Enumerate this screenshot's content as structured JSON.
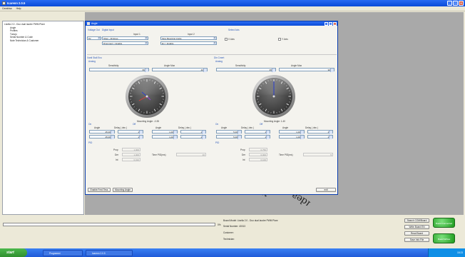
{
  "app": {
    "title": "Icarenn 2.0.5",
    "menu": [
      "Cerahisa",
      "Help"
    ]
  },
  "tree": {
    "root": "Lisella 2.0 - Duo dual Iaodre PWM Pianr",
    "children": [
      "Angle",
      "Profiles",
      "Tunujo",
      "Serial Number & Code",
      "Note Technician & Customer"
    ]
  },
  "child": {
    "title": "Angle",
    "voltage_out_label": "Voltage Out",
    "digital_input_label": "Digital Input",
    "input1_label": "Input 1",
    "input2_label": "Input 2",
    "select_axis_label": "Select Axis",
    "voltage_value": "5V",
    "input1_value": "Shep - All Enes",
    "input1b_value": "Dinonnect > Enable",
    "input2_value": "Sing Mounting Angle",
    "input2b_value": "En > Enable",
    "x_axis_label": "X Axis",
    "y_axis_label": "Y Axis",
    "panels": [
      {
        "title": "Xanti Stall Eno",
        "analog": "Analog",
        "sensitivity_label": "Sensitivity",
        "sensitivity_value": "80",
        "angle_max_label": "Angle Max",
        "angle_max_value": "40",
        "mounting_label": "Mounting Angle: -0.35",
        "on_label": "On",
        "off_label": "Off",
        "col_angle": "Angle",
        "col_delay": "Delay ( dec )",
        "row1": [
          "45,00",
          "1",
          "1,00",
          "1"
        ],
        "row2": [
          "45,00",
          "1",
          "1,00",
          "1"
        ],
        "pid_label": "PID",
        "prop_label": "Prop",
        "der_label": "Der",
        "int_label": "Int",
        "prop_val": "1,000",
        "der_val": "1,000",
        "int_val": "0,010",
        "time_label": "Time PID(ms)",
        "time_val": "10"
      },
      {
        "title": "Din Cmert",
        "analog": "Analog",
        "sensitivity_label": "Sensitivity",
        "sensitivity_value": "95",
        "angle_max_label": "Angle Max",
        "angle_max_value": "90",
        "mounting_label": "Mounting Angle: 1.40",
        "on_label": "On",
        "off_label": "Off",
        "col_angle": "Angle",
        "col_delay": "Delay ( dec )",
        "row1": [
          "5,00",
          "1",
          "1,00",
          "1"
        ],
        "row2": [
          "5,00",
          "1",
          "1,00",
          "1"
        ],
        "pid_label": "PID",
        "prop_label": "Prop",
        "der_label": "Der",
        "int_label": "Int",
        "prop_val": "0,750",
        "der_val": "0,000",
        "int_val": "0,100",
        "time_label": "Time PID(ms)",
        "time_val": "5"
      }
    ],
    "btn_enable": "Enable Fred Tess",
    "btn_mounting": "Mounting Angle",
    "btn_exit": "exit"
  },
  "status": {
    "percent": "0%",
    "board": "Board Model: Lisella 2.0 - Duo dual Iaodre PWM Pianr",
    "serial": "Serial Number: 40013",
    "customer": "Customer:",
    "technician": "Technician:",
    "search_com": "Search COM/Board",
    "write_board": "Write Board EN",
    "read_board": "Read Board",
    "save_info": "Save Info File",
    "green1": "Board Connected",
    "green2": "Board Writes"
  },
  "taskbar": {
    "start": "start",
    "task1": "Programmi",
    "task2": "Icarenn 2.0.5",
    "clock": "18:23"
  },
  "watermark": "Idea - mech",
  "colors": {
    "title_blue": "#0a4ad8",
    "green": "#1d9a1d",
    "mdi_gray": "#a9a9a9"
  }
}
